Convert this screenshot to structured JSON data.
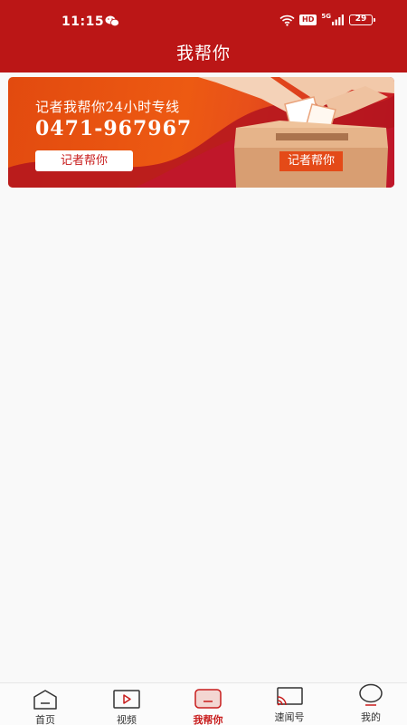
{
  "status_bar": {
    "time": "11:15",
    "network_type": "5G",
    "hd_badge": "HD",
    "battery": "29"
  },
  "header": {
    "title": "我帮你"
  },
  "banner": {
    "headline": "记者我帮你24小时专线",
    "phone": "0471-967967",
    "button_label": "记者帮你",
    "box_label": "记者帮你"
  },
  "tabbar": {
    "items": [
      {
        "label": "首页",
        "icon": "home-icon",
        "active": false
      },
      {
        "label": "视频",
        "icon": "video-icon",
        "active": false
      },
      {
        "label": "我帮你",
        "icon": "help-icon",
        "active": true
      },
      {
        "label": "速闻号",
        "icon": "cast-icon",
        "active": false
      },
      {
        "label": "我的",
        "icon": "profile-icon",
        "active": false
      }
    ]
  },
  "colors": {
    "brand_red": "#bb1616",
    "active_tab": "#c81d1d",
    "banner_orange": "#e24a0f"
  }
}
